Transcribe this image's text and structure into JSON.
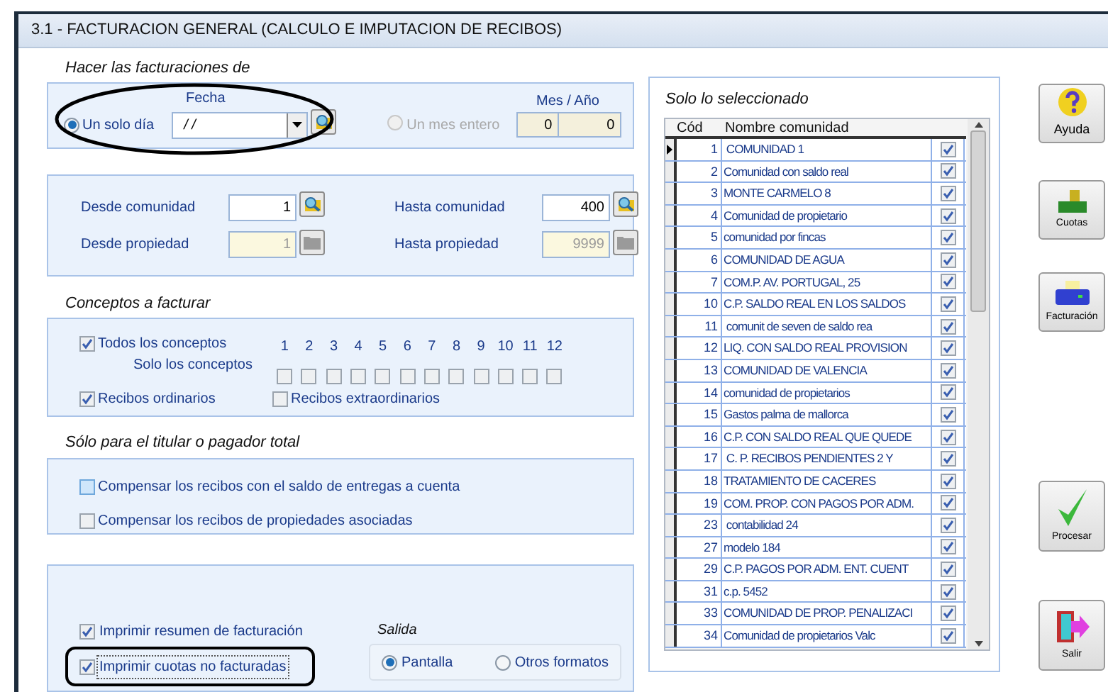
{
  "window": {
    "title": "3.1 - FACTURACION GENERAL (CALCULO E IMPUTACION DE RECIBOS)"
  },
  "billing_mode": {
    "heading": "Hacer las facturaciones de",
    "date_label": "Fecha",
    "date_value": "/ /",
    "month_year_label": "Mes / Año",
    "month": "0",
    "year": "0",
    "options": [
      {
        "label": "Un solo día",
        "selected": true,
        "disabled": false
      },
      {
        "label": "Un mes entero",
        "selected": false,
        "disabled": true
      }
    ]
  },
  "range": {
    "fields": [
      {
        "label": "Desde comunidad",
        "value": "1",
        "disabled": false
      },
      {
        "label": "Hasta comunidad",
        "value": "400",
        "disabled": false
      },
      {
        "label": "Desde propiedad",
        "value": "1",
        "disabled": true
      },
      {
        "label": "Hasta propiedad",
        "value": "9999",
        "disabled": true
      }
    ]
  },
  "concepts": {
    "heading": "Conceptos a facturar",
    "all": {
      "label": "Todos los conceptos",
      "checked": true
    },
    "only_label": "Solo los conceptos",
    "numbers": [
      {
        "label": "1",
        "checked": false
      },
      {
        "label": "2",
        "checked": false
      },
      {
        "label": "3",
        "checked": false
      },
      {
        "label": "4",
        "checked": false
      },
      {
        "label": "5",
        "checked": false
      },
      {
        "label": "6",
        "checked": false
      },
      {
        "label": "7",
        "checked": false
      },
      {
        "label": "8",
        "checked": false
      },
      {
        "label": "9",
        "checked": false
      },
      {
        "label": "10",
        "checked": false
      },
      {
        "label": "11",
        "checked": false
      },
      {
        "label": "12",
        "checked": false
      }
    ],
    "ordinary": {
      "label": "Recibos ordinarios",
      "checked": true
    },
    "extraordinary": {
      "label": "Recibos extraordinarios",
      "checked": false
    }
  },
  "holder": {
    "heading": "Sólo para el titular o pagador total",
    "options": [
      {
        "label": "Compensar los recibos con  el saldo de entregas a cuenta",
        "checked": false,
        "hover": true
      },
      {
        "label": "Compensar los recibos de propiedades asociadas",
        "checked": false,
        "hover": false
      }
    ]
  },
  "printing": {
    "options": [
      {
        "label": "Imprimir resumen de facturación",
        "checked": true,
        "focused": false
      },
      {
        "label": "Imprimir cuotas no facturadas",
        "checked": true,
        "focused": true
      }
    ],
    "output_heading": "Salida",
    "outputs": [
      {
        "label": "Pantalla",
        "selected": true
      },
      {
        "label": "Otros formatos",
        "selected": false
      }
    ]
  },
  "list": {
    "heading": "Solo lo seleccionado",
    "columns": [
      "Cód",
      "Nombre comunidad"
    ],
    "rows": [
      {
        "code": "1",
        "name": " COMUNIDAD 1",
        "checked": true,
        "current": true
      },
      {
        "code": "2",
        "name": "Comunidad con saldo real",
        "checked": true,
        "current": false
      },
      {
        "code": "3",
        "name": "MONTE CARMELO 8",
        "checked": true,
        "current": false
      },
      {
        "code": "4",
        "name": "Comunidad de propietario",
        "checked": true,
        "current": false
      },
      {
        "code": "5",
        "name": "comunidad por fincas",
        "checked": true,
        "current": false
      },
      {
        "code": "6",
        "name": "COMUNIDAD DE AGUA",
        "checked": true,
        "current": false
      },
      {
        "code": "7",
        "name": "COM.P. AV. PORTUGAL, 25",
        "checked": true,
        "current": false
      },
      {
        "code": "10",
        "name": "C.P. SALDO REAL EN LOS SALDOS",
        "checked": true,
        "current": false
      },
      {
        "code": "11",
        "name": " comunit de seven de saldo rea",
        "checked": true,
        "current": false
      },
      {
        "code": "12",
        "name": "LIQ. CON SALDO REAL PROVISION",
        "checked": true,
        "current": false
      },
      {
        "code": "13",
        "name": "COMUNIDAD DE VALENCIA",
        "checked": true,
        "current": false
      },
      {
        "code": "14",
        "name": "comunidad de propietarios",
        "checked": true,
        "current": false
      },
      {
        "code": "15",
        "name": "Gastos palma de mallorca",
        "checked": true,
        "current": false
      },
      {
        "code": "16",
        "name": "C.P. CON SALDO REAL QUE QUEDE",
        "checked": true,
        "current": false
      },
      {
        "code": "17",
        "name": " C. P. RECIBOS PENDIENTES 2 Y",
        "checked": true,
        "current": false
      },
      {
        "code": "18",
        "name": "TRATAMIENTO DE CACERES",
        "checked": true,
        "current": false
      },
      {
        "code": "19",
        "name": "COM. PROP. CON PAGOS POR ADM.",
        "checked": true,
        "current": false
      },
      {
        "code": "23",
        "name": " contabilidad 24",
        "checked": true,
        "current": false
      },
      {
        "code": "27",
        "name": "modelo 184",
        "checked": true,
        "current": false
      },
      {
        "code": "29",
        "name": "C.P. PAGOS POR ADM. ENT. CUENT",
        "checked": true,
        "current": false
      },
      {
        "code": "31",
        "name": "c.p. 5452",
        "checked": true,
        "current": false
      },
      {
        "code": "33",
        "name": "COMUNIDAD DE PROP. PENALIZACI",
        "checked": true,
        "current": false
      },
      {
        "code": "34",
        "name": "Comunidad de propietarios Valc",
        "checked": true,
        "current": false
      }
    ]
  },
  "buttons": [
    {
      "label": "Ayuda",
      "kind": "help"
    },
    {
      "label": "Cuotas",
      "kind": "fees"
    },
    {
      "label": "Facturación",
      "kind": "billing"
    },
    {
      "label": "Procesar",
      "kind": "process"
    },
    {
      "label": "Salir",
      "kind": "exit"
    }
  ]
}
